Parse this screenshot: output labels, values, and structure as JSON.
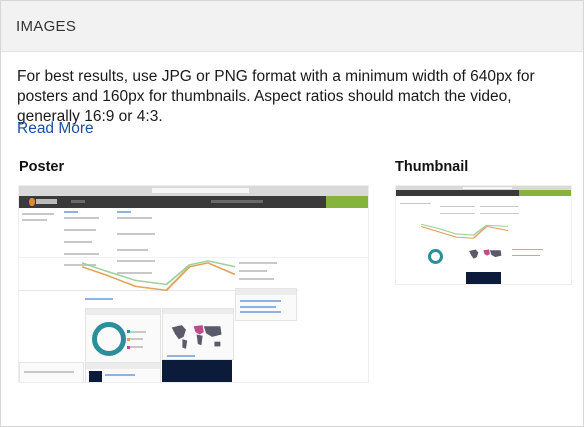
{
  "header": {
    "title": "IMAGES"
  },
  "description": "For best results, use JPG or PNG format with a minimum width of 640px for posters and 160px for thumbnails. Aspect ratios should match the video, generally 16:9 or 4:3.",
  "read_more": "Read More",
  "poster": {
    "label": "Poster"
  },
  "thumbnail": {
    "label": "Thumbnail"
  },
  "colors": {
    "link": "#1d4e9a",
    "header_bg": "#f2f2f2",
    "app_header": "#3a3a3a",
    "brand_green": "#86b33b",
    "donut": "#2b8f9b"
  }
}
